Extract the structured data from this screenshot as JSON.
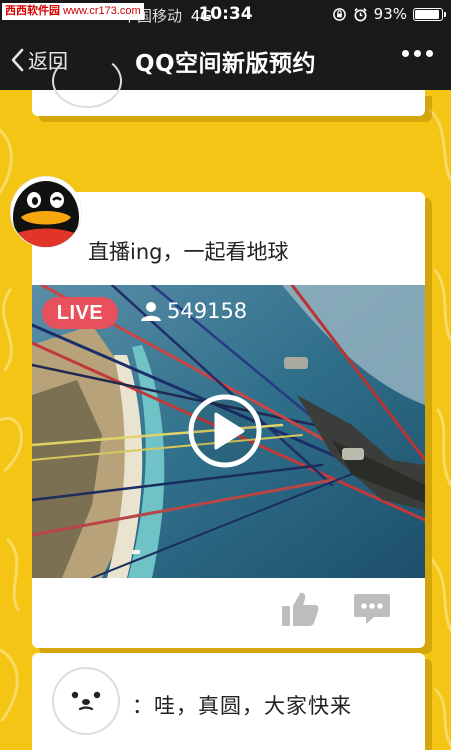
{
  "watermark": {
    "brand": "西西软件园",
    "url": "www.cr173.com"
  },
  "status_bar": {
    "carrier": "中国移动",
    "network": "4G",
    "time": "10:34",
    "battery": "93%",
    "battery_level": 0.93
  },
  "navbar": {
    "back_label": "返回",
    "title": "QQ空间新版预约"
  },
  "post": {
    "text": "直播ing，一起看地球",
    "live_label": "LIVE",
    "viewer_count": "549158"
  },
  "comment": {
    "text": "：哇，真圆，大家快来"
  },
  "colors": {
    "background": "#f5c516",
    "live_badge": "#e8505b",
    "navbar": "#1a1a1a"
  },
  "icons": [
    "back-chevron-icon",
    "more-dots-icon",
    "user-icon",
    "play-icon",
    "thumbs-up-icon",
    "comment-icon",
    "lock-rotation-icon",
    "alarm-icon",
    "battery-icon"
  ]
}
